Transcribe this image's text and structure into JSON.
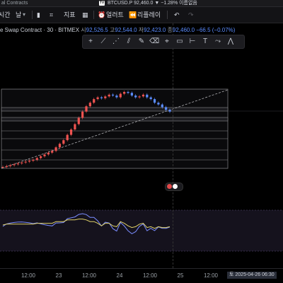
{
  "topbar": {
    "tab_label": "al Contracts",
    "logo": "TV",
    "ticker": "BTCUSD.P 92,460.0 ▼ −1.28% 이름없음"
  },
  "toolbar": {
    "left_label": "시간",
    "left_value": "날",
    "indicator_label": "지표",
    "alert_label": "얼러트",
    "replay_label": "리플레이",
    "icons": [
      "chevron-down-icon",
      "grid-icon",
      "indicator-icon",
      "layout-icon",
      "alert-icon",
      "replay-icon",
      "undo-icon",
      "redo-icon"
    ]
  },
  "legend": {
    "title": "e Swap Contract · 30 · BITMEX",
    "o_label": "시",
    "o_value": "92,526.5",
    "h_label": "고",
    "h_value": "92,544.0",
    "l_label": "저",
    "l_value": "92,423.0",
    "c_label": "종",
    "c_value": "92,460.0",
    "change": "−66.5 (−0.07%)"
  },
  "drawing_tools": [
    "cursor-icon",
    "trendline-icon",
    "fib-icon",
    "channel-icon",
    "brush-icon",
    "eraser-icon",
    "ruler-icon",
    "rectangle-icon",
    "text-icon",
    "path-icon",
    "pattern-icon",
    "more-icon"
  ],
  "x_axis": {
    "ticks": [
      "12:00",
      "23",
      "12:00",
      "24",
      "12:00",
      "25",
      "12:00"
    ],
    "date_badge": "토 2025-04-26",
    "time_badge": "06:30"
  },
  "colors": {
    "up_candle": "#ef5350",
    "down_candle": "#5b8cff",
    "indicator_line": "#7a8cff",
    "signal_line": "#e0d26a",
    "grid_band": "#1e1e21"
  },
  "chart_data": {
    "type": "line",
    "title": "",
    "series": [
      {
        "values": [
          0,
          1,
          2,
          3,
          4,
          5,
          6,
          7,
          8,
          10,
          12,
          14,
          16,
          18,
          22,
          26,
          30,
          36,
          42,
          48,
          55,
          62,
          68,
          72,
          76,
          78,
          77,
          79,
          81,
          80,
          78,
          82,
          84,
          83,
          80,
          78,
          79,
          81,
          78,
          76,
          72,
          70,
          67,
          64,
          62
        ]
      }
    ]
  }
}
